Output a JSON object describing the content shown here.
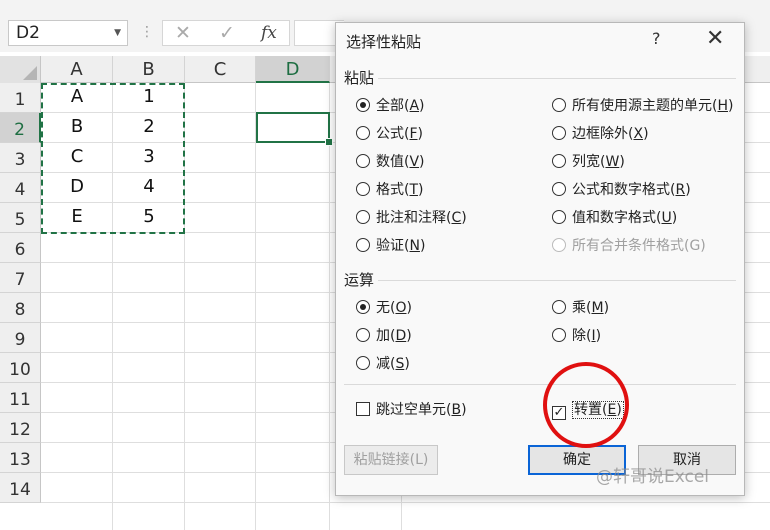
{
  "formula_bar": {
    "name_box": "D2",
    "cancel_glyph": "✕",
    "enter_glyph": "✓",
    "fx_label": "fx",
    "value": ""
  },
  "sheet": {
    "columns": [
      "A",
      "B",
      "C",
      "D"
    ],
    "rows": [
      "1",
      "2",
      "3",
      "4",
      "5",
      "6",
      "7",
      "8",
      "9",
      "10",
      "11",
      "12",
      "13",
      "14"
    ],
    "selected_column": "D",
    "selected_row": "2",
    "cells": [
      {
        "col": "A",
        "row": 1,
        "value": "A"
      },
      {
        "col": "B",
        "row": 1,
        "value": "1"
      },
      {
        "col": "A",
        "row": 2,
        "value": "B"
      },
      {
        "col": "B",
        "row": 2,
        "value": "2"
      },
      {
        "col": "A",
        "row": 3,
        "value": "C"
      },
      {
        "col": "B",
        "row": 3,
        "value": "3"
      },
      {
        "col": "A",
        "row": 4,
        "value": "D"
      },
      {
        "col": "B",
        "row": 4,
        "value": "4"
      },
      {
        "col": "A",
        "row": 5,
        "value": "E"
      },
      {
        "col": "B",
        "row": 5,
        "value": "5"
      }
    ],
    "accent_color": "#217346"
  },
  "dialog": {
    "title": "选择性粘贴",
    "help": "?",
    "close": "✕",
    "paste_group": {
      "label": "粘贴",
      "options": [
        {
          "text": "全部(",
          "key": "A",
          "tail": ")",
          "selected": true
        },
        {
          "text": "所有使用源主题的单元(",
          "key": "H",
          "tail": ")",
          "selected": false
        },
        {
          "text": "公式(",
          "key": "F",
          "tail": ")",
          "selected": false
        },
        {
          "text": "边框除外(",
          "key": "X",
          "tail": ")",
          "selected": false
        },
        {
          "text": "数值(",
          "key": "V",
          "tail": ")",
          "selected": false
        },
        {
          "text": "列宽(",
          "key": "W",
          "tail": ")",
          "selected": false
        },
        {
          "text": "格式(",
          "key": "T",
          "tail": ")",
          "selected": false
        },
        {
          "text": "公式和数字格式(",
          "key": "R",
          "tail": ")",
          "selected": false
        },
        {
          "text": "批注和注释(",
          "key": "C",
          "tail": ")",
          "selected": false
        },
        {
          "text": "值和数字格式(",
          "key": "U",
          "tail": ")",
          "selected": false
        },
        {
          "text": "验证(",
          "key": "N",
          "tail": ")",
          "selected": false
        },
        {
          "text": "所有合并条件格式(G)",
          "key": "",
          "tail": "",
          "selected": false,
          "disabled": true
        }
      ]
    },
    "operation_group": {
      "label": "运算",
      "options": [
        {
          "text": "无(",
          "key": "O",
          "tail": ")",
          "selected": true
        },
        {
          "text": "乘(",
          "key": "M",
          "tail": ")",
          "selected": false
        },
        {
          "text": "加(",
          "key": "D",
          "tail": ")",
          "selected": false
        },
        {
          "text": "除(",
          "key": "I",
          "tail": ")",
          "selected": false
        },
        {
          "text": "减(",
          "key": "S",
          "tail": ")",
          "selected": false
        }
      ]
    },
    "skip_blanks": {
      "text": "跳过空单元(",
      "key": "B",
      "tail": ")",
      "checked": false
    },
    "transpose": {
      "text": "转置(",
      "key": "E",
      "tail": ")",
      "checked": true,
      "check_glyph": "✓"
    },
    "buttons": {
      "paste_link": "粘贴链接(L)",
      "ok": "确定",
      "cancel": "取消"
    }
  },
  "annotation": {
    "circle_color": "#e01010"
  },
  "watermark": "@轩哥说Excel"
}
